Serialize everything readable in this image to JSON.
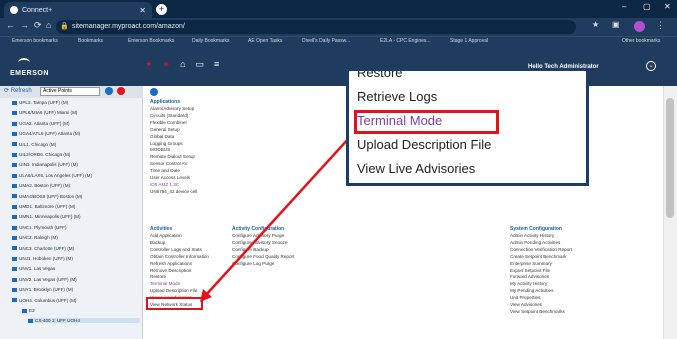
{
  "browser": {
    "tab_title": "Connect+",
    "url": "sitemanager.myproact.com/amazon/",
    "window_controls": [
      "–",
      "▢",
      "✕"
    ]
  },
  "bookmarks": [
    "Emerson bookmarks",
    "Bookmarks",
    "Emerson Bookmarks",
    "Daily Bookmarks",
    "AE Open Tasks",
    "Divell's Daily Passw...",
    "E2LA - CPC Engines...",
    "Stage 1 Approval",
    "Other bookmarks"
  ],
  "app": {
    "logo": "EMERSON",
    "user": "Hello  Tech Administrator"
  },
  "sidebar": {
    "refresh": "Refresh",
    "filter": "Active Points",
    "items": [
      "UPL3. Tampa (UFF) (M)",
      "UPL6/MIA6 (UFF) Miami (M)",
      "UGA2. Atlanta (UFF) (M)",
      "UGA4/ATL6 (UFF) Atlanta (M)",
      "UIL1. Chicago (M)",
      "UIL2/ORD6. Chicago (M)",
      "UIN1. Indianapolis (UFF) (M)",
      "ULA6/LAX6. Los Angeles (UFF) (M)",
      "UMA2. Boston (UFF) (M)",
      "UMA4/BOS6 (UFF) Boston (M)",
      "UMD1. Baltimore (UFF) (M)",
      "UMN1. Minneapolis (UFF) (M)",
      "UNC1. Plymouth (UFF)",
      "UNC2. Raleigh (M)",
      "UNC3. Charlotte (UFF) (M)",
      "UNJ1. Hoboken (UFF) (M)",
      "UNV1. Las Vegas",
      "UNV2. Las Vegas (UFF) (M)",
      "UNY1. Brooklyn (UFF) (M)",
      "UOH4. Columbus (UFF) (M)",
      "E2",
      "CX-400 1: UFF UOH4"
    ]
  },
  "main": {
    "applications_header": "Applications",
    "applications": [
      "Alarm/Advisory Setup",
      "Circuits (Standard)",
      "Flexible Combiner",
      "General Setup",
      "Global Data",
      "Logging Groups",
      "MODBUS",
      "Remote Dialout Setup",
      "Sensor Control AV",
      "Time and Date",
      "User Access Levels",
      "IO5 AMZ 1.3C",
      "UN6794_42 device cell"
    ],
    "activities_header": "Activities",
    "activities": [
      "Add Application",
      "Backup",
      "Controller Logs and Stats",
      "Obtain Controller Information",
      "Refresh Applications",
      "Remove Description",
      "Restore",
      "Terminal Mode",
      "Upload Description File",
      "View Live Advisories",
      "View Network Status"
    ],
    "activity_config_header": "Activity Configuration",
    "activity_config": [
      "Configure Advisory Purge",
      "Configure Advisory Snooze",
      "Configure Backup",
      "Configure Food Quality Report",
      "Configure Log Purge"
    ],
    "system_config_header": "System Configuration",
    "system_config": [
      "Admin Activity History",
      "Admin Pending Activities",
      "Connection Verification Report",
      "Create Setpoint Benchmark",
      "Enterprise Summary",
      "Export Setpoint File",
      "Forward Advisories",
      "My Activity History",
      "My Pending Activities",
      "Unit Properties",
      "View Advisories",
      "View Setpoint Benchmarks"
    ]
  },
  "zoom": {
    "items": [
      "Restore",
      "Retrieve Logs",
      "Terminal Mode",
      "Upload Description File",
      "View Live Advisories"
    ]
  },
  "colors": {
    "highlight": "#e2131b",
    "header": "#1f3c5e",
    "accent": "#7a3fa5"
  }
}
